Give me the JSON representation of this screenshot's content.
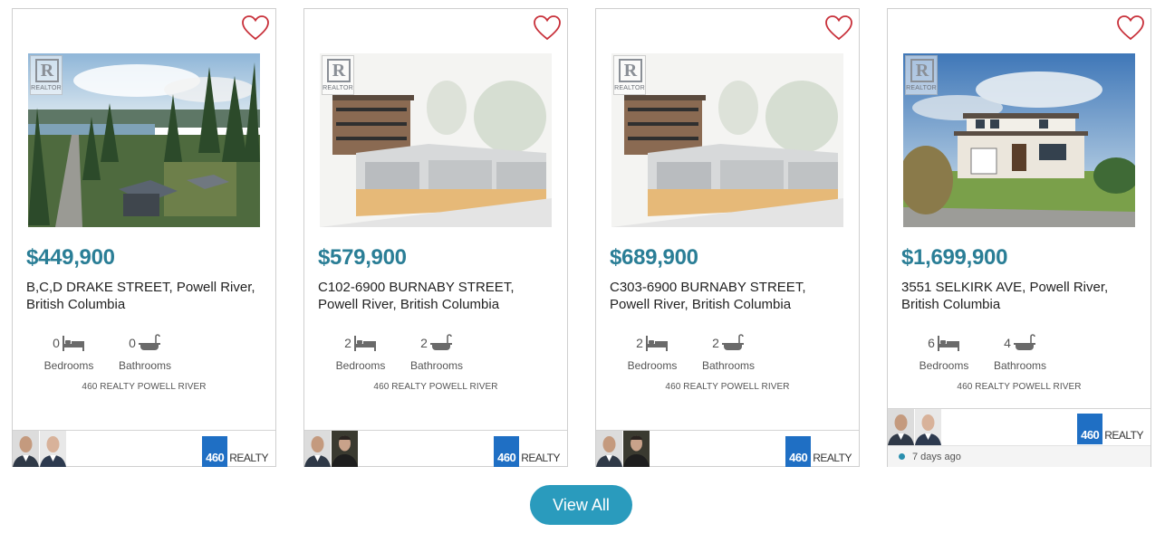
{
  "listings": [
    {
      "price": "$449,900",
      "address": "B,C,D DRAKE STREET, Powell River, British Columbia",
      "bedrooms": "0",
      "bathrooms": "0",
      "bedrooms_label": "Bedrooms",
      "bathrooms_label": "Bathrooms",
      "brokerage": "460 REALTY POWELL RIVER",
      "realtor_badge": "REALTOR",
      "logo_number": "460",
      "logo_text": "REALTY"
    },
    {
      "price": "$579,900",
      "address": "C102-6900 BURNABY STREET, Powell River, British Columbia",
      "bedrooms": "2",
      "bathrooms": "2",
      "bedrooms_label": "Bedrooms",
      "bathrooms_label": "Bathrooms",
      "brokerage": "460 REALTY POWELL RIVER",
      "realtor_badge": "REALTOR",
      "logo_number": "460",
      "logo_text": "REALTY"
    },
    {
      "price": "$689,900",
      "address": "C303-6900 BURNABY STREET, Powell River, British Columbia",
      "bedrooms": "2",
      "bathrooms": "2",
      "bedrooms_label": "Bedrooms",
      "bathrooms_label": "Bathrooms",
      "brokerage": "460 REALTY POWELL RIVER",
      "realtor_badge": "REALTOR",
      "logo_number": "460",
      "logo_text": "REALTY"
    },
    {
      "price": "$1,699,900",
      "address": "3551 SELKIRK AVE, Powell River, British Columbia",
      "bedrooms": "6",
      "bathrooms": "4",
      "bedrooms_label": "Bedrooms",
      "bathrooms_label": "Bathrooms",
      "brokerage": "460 REALTY POWELL RIVER",
      "realtor_badge": "REALTOR",
      "logo_number": "460",
      "logo_text": "REALTY",
      "listed_ago": "7 days ago"
    }
  ],
  "view_all_label": "View All",
  "icons": {
    "favorite": "heart-outline-icon",
    "bed": "bed-icon",
    "bath": "bathtub-icon"
  },
  "colors": {
    "price": "#2a7e96",
    "heart": "#c8303a",
    "button": "#2a9bbd",
    "logo": "#1f6fc4"
  }
}
